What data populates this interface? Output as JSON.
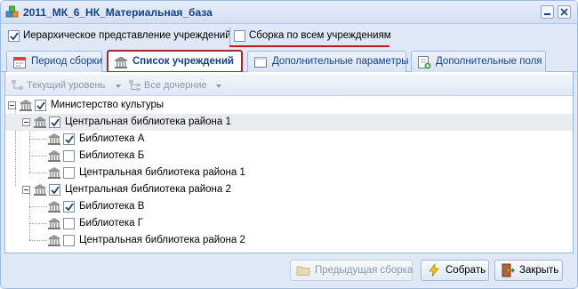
{
  "window": {
    "title": "2011_МК_6_НК_Материальная_база"
  },
  "options": {
    "hierarchical_label": "Иерархическое представление учреждений",
    "hierarchical_checked": true,
    "collect_all_label": "Сборка по всем учреждениям",
    "collect_all_checked": false
  },
  "tabs": [
    {
      "label": "Период сборки",
      "icon": "calendar-icon",
      "active": false
    },
    {
      "label": "Список учреждений",
      "icon": "building-icon",
      "active": true
    },
    {
      "label": "Дополнительные параметры",
      "icon": "panel-icon",
      "active": false
    },
    {
      "label": "Дополнительные поля",
      "icon": "add-field-icon",
      "active": false
    }
  ],
  "toolbar": {
    "current_level": "Текущий уровень",
    "all_children": "Все дочерние"
  },
  "tree": [
    {
      "label": "Министерство культуры",
      "checked": true,
      "level": 0,
      "expandable": true
    },
    {
      "label": "Центральная библиотека района 1",
      "checked": true,
      "level": 1,
      "expandable": true,
      "selected": true
    },
    {
      "label": "Библиотека А",
      "checked": true,
      "level": 2
    },
    {
      "label": "Библиотека Б",
      "checked": false,
      "level": 2
    },
    {
      "label": "Центральная библиотека района 1",
      "checked": false,
      "level": 2
    },
    {
      "label": "Центральная библиотека района 2",
      "checked": true,
      "level": 1,
      "expandable": true
    },
    {
      "label": "Библиотека В",
      "checked": true,
      "level": 2
    },
    {
      "label": "Библиотека Г",
      "checked": false,
      "level": 2
    },
    {
      "label": "Центральная библиотека района 2",
      "checked": false,
      "level": 2
    }
  ],
  "buttons": {
    "previous": "Предыдущая сборка",
    "collect": "Собрать",
    "close": "Закрыть"
  },
  "colors": {
    "accent_red": "#c0191f",
    "title_blue": "#15428b",
    "border_blue": "#99bbe8"
  }
}
